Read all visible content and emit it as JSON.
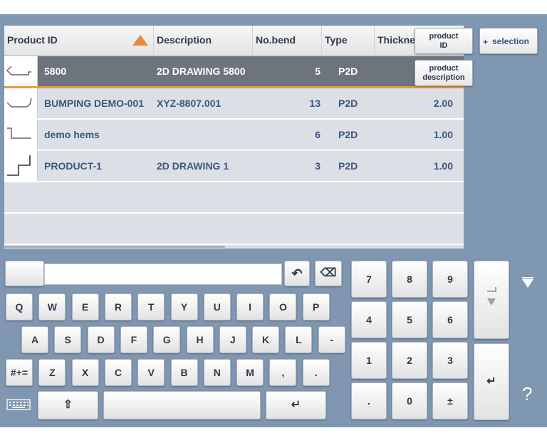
{
  "table": {
    "headers": {
      "product_id": "Product ID",
      "description": "Description",
      "no_bend": "No.bend",
      "type": "Type",
      "thickness": "Thickness"
    },
    "rows": [
      {
        "id": "5800",
        "description": "2D DRAWING 5800",
        "bends": "5",
        "type": "P2D",
        "thickness": "",
        "selected": true
      },
      {
        "id": "BUMPING DEMO-001",
        "description": "XYZ-8807.001",
        "bends": "13",
        "type": "P2D",
        "thickness": "2.00",
        "selected": false
      },
      {
        "id": "demo hems",
        "description": "",
        "bends": "6",
        "type": "P2D",
        "thickness": "1.00",
        "selected": false
      },
      {
        "id": "PRODUCT-1",
        "description": "2D DRAWING 1",
        "bends": "3",
        "type": "P2D",
        "thickness": "1.00",
        "selected": false
      }
    ],
    "sort_indicator_color": "#e88a3a",
    "selected_row_color": "#6e747c"
  },
  "buttons": {
    "product_id": {
      "line1": "product",
      "line2": "ID"
    },
    "product_description": {
      "line1": "product",
      "line2": "description"
    },
    "selection": {
      "plus": "+",
      "label": "selection"
    }
  },
  "keyboard": {
    "input_value": "",
    "undo": "↶",
    "backspace": "⌫",
    "row1": [
      "Q",
      "W",
      "E",
      "R",
      "T",
      "Y",
      "U",
      "I",
      "O",
      "P"
    ],
    "row2": [
      "A",
      "S",
      "D",
      "F",
      "G",
      "H",
      "J",
      "K",
      "L",
      "-"
    ],
    "row3": [
      "#+=",
      "Z",
      "X",
      "C",
      "V",
      "B",
      "N",
      "M",
      ",",
      "."
    ],
    "shift": "⇧",
    "enter": "↵",
    "numpad": [
      "7",
      "8",
      "9",
      "4",
      "5",
      "6",
      "1",
      "2",
      "3",
      ".",
      "0",
      "±"
    ],
    "numpad_enter": "↵"
  },
  "side": {
    "help": "?"
  }
}
